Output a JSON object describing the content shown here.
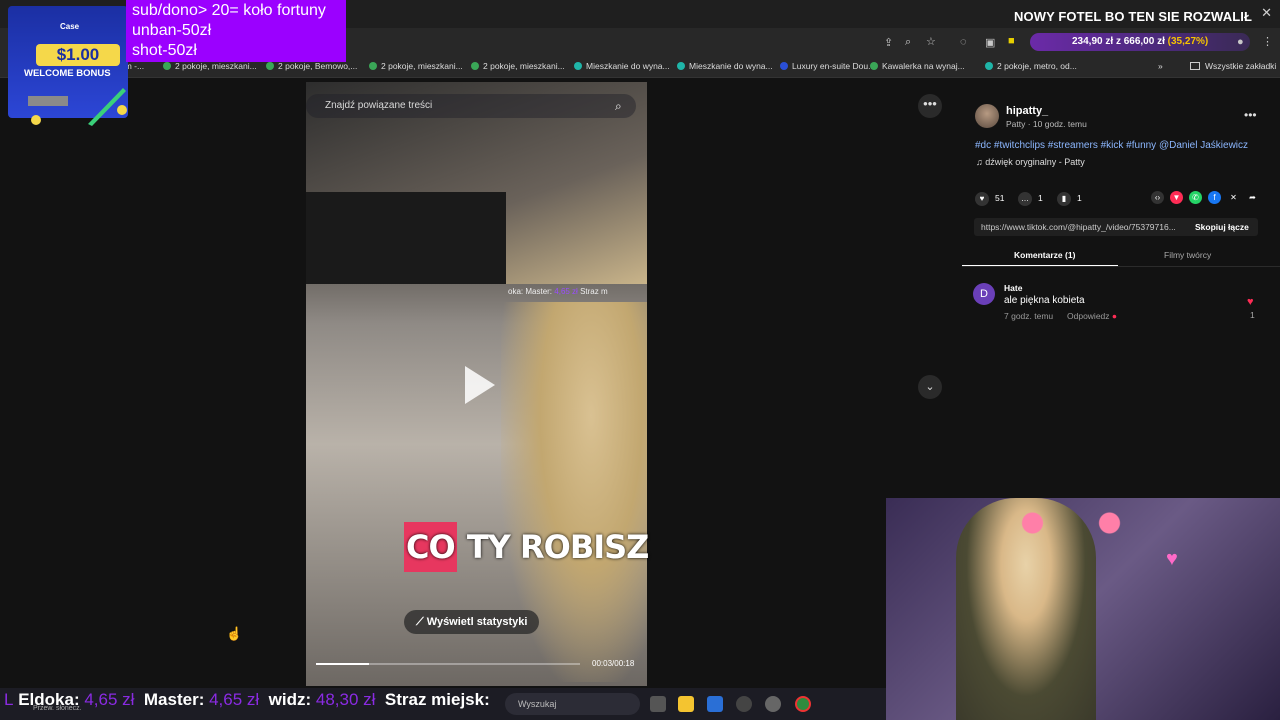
{
  "stream": {
    "title": "NOWY FOTEL BO TEN SIE ROZWALIŁ"
  },
  "overlay": {
    "case_logo": "Case",
    "bonus_amount": "$1.00",
    "bonus_label": "WELCOME BONUS",
    "rules": [
      "sub/dono> 20= koło fortuny",
      "unban-50zł",
      "shot-50zł"
    ]
  },
  "browser": {
    "price_bar": {
      "current": "234,90 zł",
      "separator": "z",
      "goal": "666,00 zł",
      "percent": "(35,27%)"
    },
    "bookmarks": [
      "um -...",
      "2 pokoje, mieszkani...",
      "2 pokoje, Bemowo,...",
      "2 pokoje, mieszkani...",
      "2 pokoje, mieszkani...",
      "Mieszkanie do wyna...",
      "Mieszkanie do wyna...",
      "Luxury en-suite Dou...",
      "Kawalerka na wynaj...",
      "2 pokoje, metro, od..."
    ],
    "bookmarks_overflow": "»",
    "all_bookmarks": "Wszystkie zakładki",
    "bookmark_colors": [
      "#3aa657",
      "#3aa657",
      "#3aa657",
      "#3aa657",
      "#3aa657",
      "#1fb5a8",
      "#1fb5a8",
      "#2a4fd6",
      "#3aa657",
      "#1fb5a8"
    ]
  },
  "video": {
    "search_placeholder": "Znajdź powiązane treści",
    "caption_part1": "CO",
    "caption_part2": " TY ROBISZ",
    "stats_button": "Wyświetl statystyki",
    "time": "00:03/00:18",
    "progress": 0.2,
    "inner_overlay": {
      "label1": "oka:",
      "label2": "Master:",
      "value2": "4,65 zł",
      "label3": "Straz m"
    }
  },
  "post": {
    "author": "hipatty_",
    "author_sub": "Patty · 10 godz. temu",
    "hashtags": "#dc #twitchclips #streamers #kick #funny @Daniel Jaśkiewicz",
    "sound": "dźwięk oryginalny - Patty",
    "likes": "51",
    "comments": "1",
    "saves": "1",
    "link": "https://www.tiktok.com/@hipatty_/video/75379716...",
    "copy_link": "Skopiuj łącze",
    "tabs": [
      "Komentarze (1)",
      "Filmy twórcy"
    ]
  },
  "comment": {
    "avatar_letter": "D",
    "user": "Hate",
    "text": "ale piękna kobieta",
    "time": "7 godz. temu",
    "reply": "Odpowiedz",
    "like_count": "1"
  },
  "ticker": {
    "prefix": "L",
    "items": [
      {
        "name": "Eldoka:",
        "value": "4,65 zł"
      },
      {
        "name": "Master:",
        "value": "4,65 zł"
      },
      {
        "name": "widz:",
        "value": "48,30 zł"
      },
      {
        "name": "Straz miejsk:",
        "value": ""
      }
    ],
    "weather": "Przew. słonecz."
  },
  "taskbar": {
    "search_placeholder": "Wyszukaj"
  },
  "colors": {
    "accent_purple": "#9b00ff",
    "tiktok_red": "#fe2c55",
    "link_blue": "#8cb7ff"
  }
}
